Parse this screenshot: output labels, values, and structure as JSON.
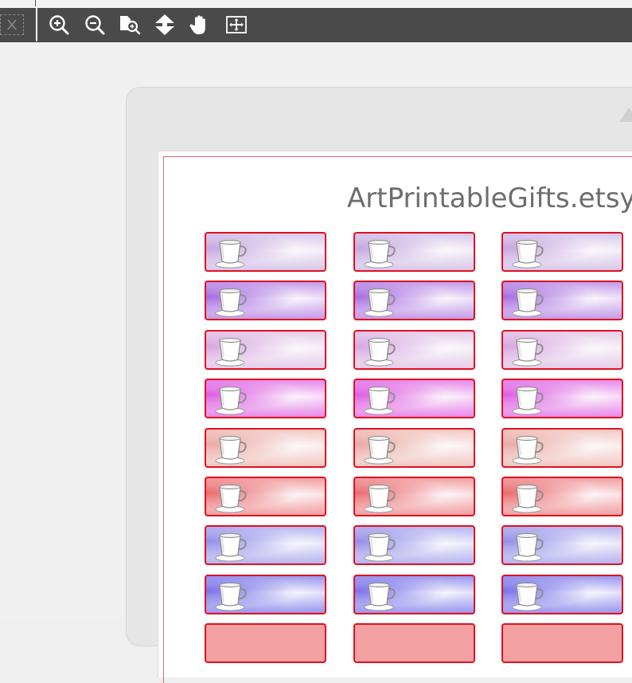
{
  "toolbar": {
    "buttons": [
      {
        "name": "zoom-in-button",
        "icon": "zoom-in-icon"
      },
      {
        "name": "zoom-out-button",
        "icon": "zoom-out-icon"
      },
      {
        "name": "zoom-fit-button",
        "icon": "zoom-page-icon"
      },
      {
        "name": "scroll-mode-button",
        "icon": "up-down-arrows-icon"
      },
      {
        "name": "pan-button",
        "icon": "hand-icon"
      },
      {
        "name": "fit-width-button",
        "icon": "fit-box-icon"
      }
    ]
  },
  "document": {
    "watermark": "ArtPrintableGifts.etsy.c"
  },
  "stickers": {
    "icon": "coffee-cup-icon",
    "columns": 3,
    "row_colors": [
      {
        "top": "#d9c8ea",
        "left": "#c7a6e0"
      },
      {
        "top": "#c59be9",
        "left": "#a66fe2"
      },
      {
        "top": "#e5cce9",
        "left": "#d7a7e1"
      },
      {
        "top": "#e889ea",
        "left": "#dd5fe3"
      },
      {
        "top": "#f2c9c4",
        "left": "#e9a9a3"
      },
      {
        "top": "#f2a0a2",
        "left": "#ea6b6f"
      },
      {
        "top": "#b7b4f0",
        "left": "#928ee9"
      },
      {
        "top": "#9b97ef",
        "left": "#7a72e9"
      }
    ]
  },
  "colors": {
    "toolbar_bg": "#4a4a4a",
    "sticker_border": "#e01020",
    "page_border": "#e96b6b"
  }
}
